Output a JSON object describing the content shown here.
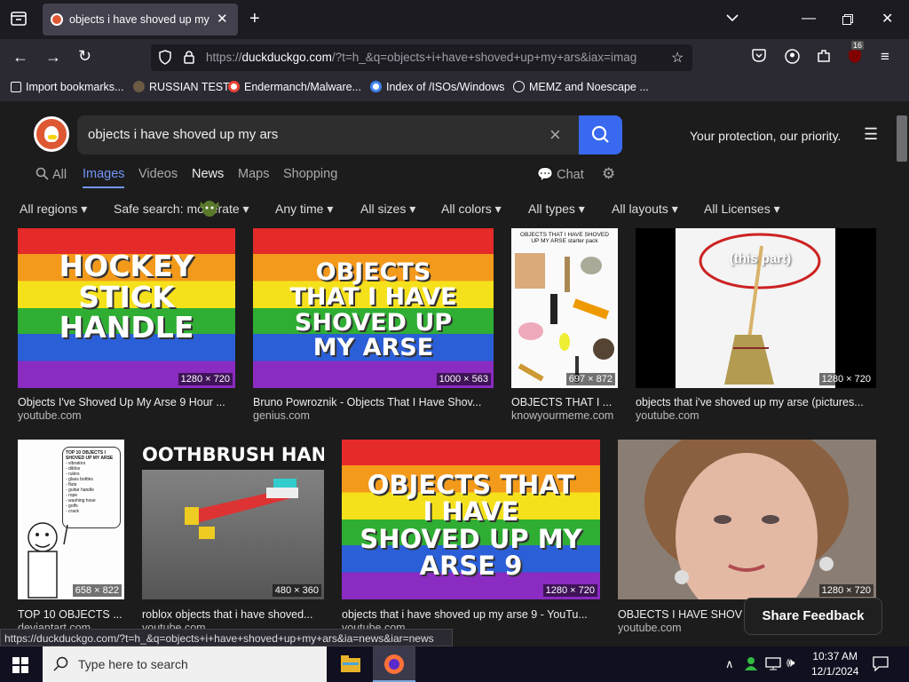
{
  "browser": {
    "tab_title": "objects i have shoved up my ars",
    "url_prefix": "https://",
    "url_host": "duckduckgo.com",
    "url_rest": "/?t=h_&q=objects+i+have+shoved+up+my+ars&iax=imag",
    "bookmarks": [
      {
        "label": "Import bookmarks...",
        "color": "#fbfbfe"
      },
      {
        "label": "RUSSIAN TEST",
        "color": "#5a4a3a"
      },
      {
        "label": "Endermanch/Malware...",
        "color": "#ffffff"
      },
      {
        "label": "Index of /ISOs/Windows",
        "color": "#ffffff"
      },
      {
        "label": "MEMZ and Noescape ...",
        "color": "#ffffff"
      }
    ],
    "extension_badge": "16"
  },
  "ddg": {
    "query": "objects i have shoved up my ars",
    "protection": "Your protection, our priority.",
    "tabs": [
      "All",
      "Images",
      "Videos",
      "News",
      "Maps",
      "Shopping"
    ],
    "chat": "Chat",
    "filters": [
      "All regions",
      "Safe search: moderate",
      "Any time",
      "All sizes",
      "All colors",
      "All types",
      "All layouts",
      "All Licenses"
    ]
  },
  "images": [
    {
      "text": "HOCKEY STICK HANDLE",
      "dims": "1280 × 720",
      "caption": "Objects I've Shoved Up My Arse 9 Hour ...",
      "source": "youtube.com"
    },
    {
      "text": "OBJECTS THAT I HAVE SHOVED UP MY ARSE",
      "dims": "1000 × 563",
      "caption": "Bruno Powroznik - Objects That I Have Shov...",
      "source": "genius.com"
    },
    {
      "text": "OBJECTS THAT I HAVE SHOVED UP MY ARSE starter pack",
      "dims": "697 × 872",
      "caption": "OBJECTS THAT I ...",
      "source": "knowyourmeme.com"
    },
    {
      "text": "(this part)",
      "dims": "1280 × 720",
      "caption": "objects that i've shoved up my arse (pictures...",
      "source": "youtube.com"
    },
    {
      "text": "TOP 10 OBJECTS I SHOVED UP MY ARSE",
      "dims": "658 × 822",
      "caption": "TOP 10 OBJECTS ...",
      "source": "deviantart.com"
    },
    {
      "text": "OOTHBRUSH HANDLE",
      "dims": "480 × 360",
      "caption": "roblox objects that i have shoved...",
      "source": "youtube.com"
    },
    {
      "text": "OBJECTS THAT I HAVE SHOVED UP MY ARSE 9",
      "dims": "1280 × 720",
      "caption": "objects that i have shoved up my arse 9 - YouTu...",
      "source": "youtube.com"
    },
    {
      "text": "",
      "dims": "1280 × 720",
      "caption": "OBJECTS I HAVE SHOV",
      "source": "youtube.com"
    }
  ],
  "top10_list": [
    "vibrators",
    "dildos",
    "rulers",
    "glass bottles",
    "flute",
    "guitar handle",
    "rope",
    "washing hose",
    "golfs",
    "crack"
  ],
  "status_url": "https://duckduckgo.com/?t=h_&q=objects+i+have+shoved+up+my+ars&ia=news&iar=news",
  "feedback": "Share Feedback",
  "taskbar": {
    "search": "Type here to search",
    "time": "10:37 AM",
    "date": "12/1/2024"
  }
}
